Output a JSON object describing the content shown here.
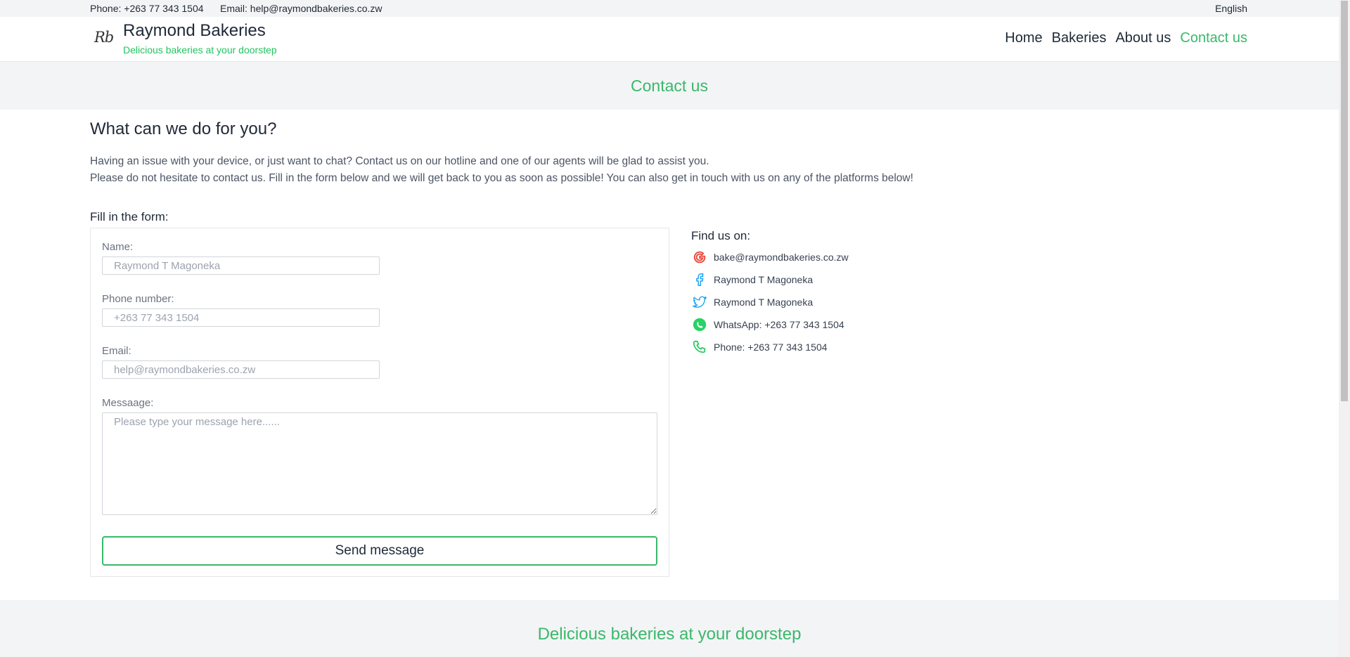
{
  "topbar": {
    "phone": "Phone: +263 77 343 1504",
    "email": "Email: help@raymondbakeries.co.zw",
    "language": "English"
  },
  "header": {
    "logo_text": "Rb",
    "brand_name": "Raymond Bakeries",
    "tagline": "Delicious bakeries at your doorstep",
    "nav": [
      {
        "label": "Home"
      },
      {
        "label": "Bakeries"
      },
      {
        "label": "About us"
      },
      {
        "label": "Contact us",
        "active": true
      }
    ]
  },
  "banner": {
    "title": "Contact us"
  },
  "intro": {
    "title": "What can we do for you?",
    "line1": "Having an issue with your device, or just want to chat? Contact us on our hotline and one of our agents will be glad to assist you.",
    "line2": "Please do not hesitate to contact us. Fill in the form below and we will get back to you as soon as possible! You can also get in touch with us on any of the platforms below!"
  },
  "form": {
    "title": "Fill in the form:",
    "name_label": "Name:",
    "name_placeholder": "Raymond T Magoneka",
    "phone_label": "Phone number:",
    "phone_placeholder": "+263 77 343 1504",
    "email_label": "Email:",
    "email_placeholder": "help@raymondbakeries.co.zw",
    "message_label": "Messaage:",
    "message_placeholder": "Please type your message here......",
    "send_label": "Send message"
  },
  "find_us": {
    "title": "Find us on:",
    "items": [
      {
        "icon": "google-icon",
        "text": "bake@raymondbakeries.co.zw",
        "color": "#ea4335"
      },
      {
        "icon": "facebook-icon",
        "text": "Raymond T Magoneka",
        "color": "#1da1f2"
      },
      {
        "icon": "twitter-icon",
        "text": "Raymond T Magoneka",
        "color": "#1da1f2"
      },
      {
        "icon": "whatsapp-icon",
        "text": "WhatsApp: +263 77 343 1504",
        "color": "#25d366"
      },
      {
        "icon": "phone-icon",
        "text": "Phone: +263 77 343 1504",
        "color": "#22c55e"
      }
    ]
  },
  "footer": {
    "tagline": "Delicious bakeries at your doorstep"
  },
  "colors": {
    "accent": "#3ab86a",
    "light_bg": "#f3f4f6"
  }
}
